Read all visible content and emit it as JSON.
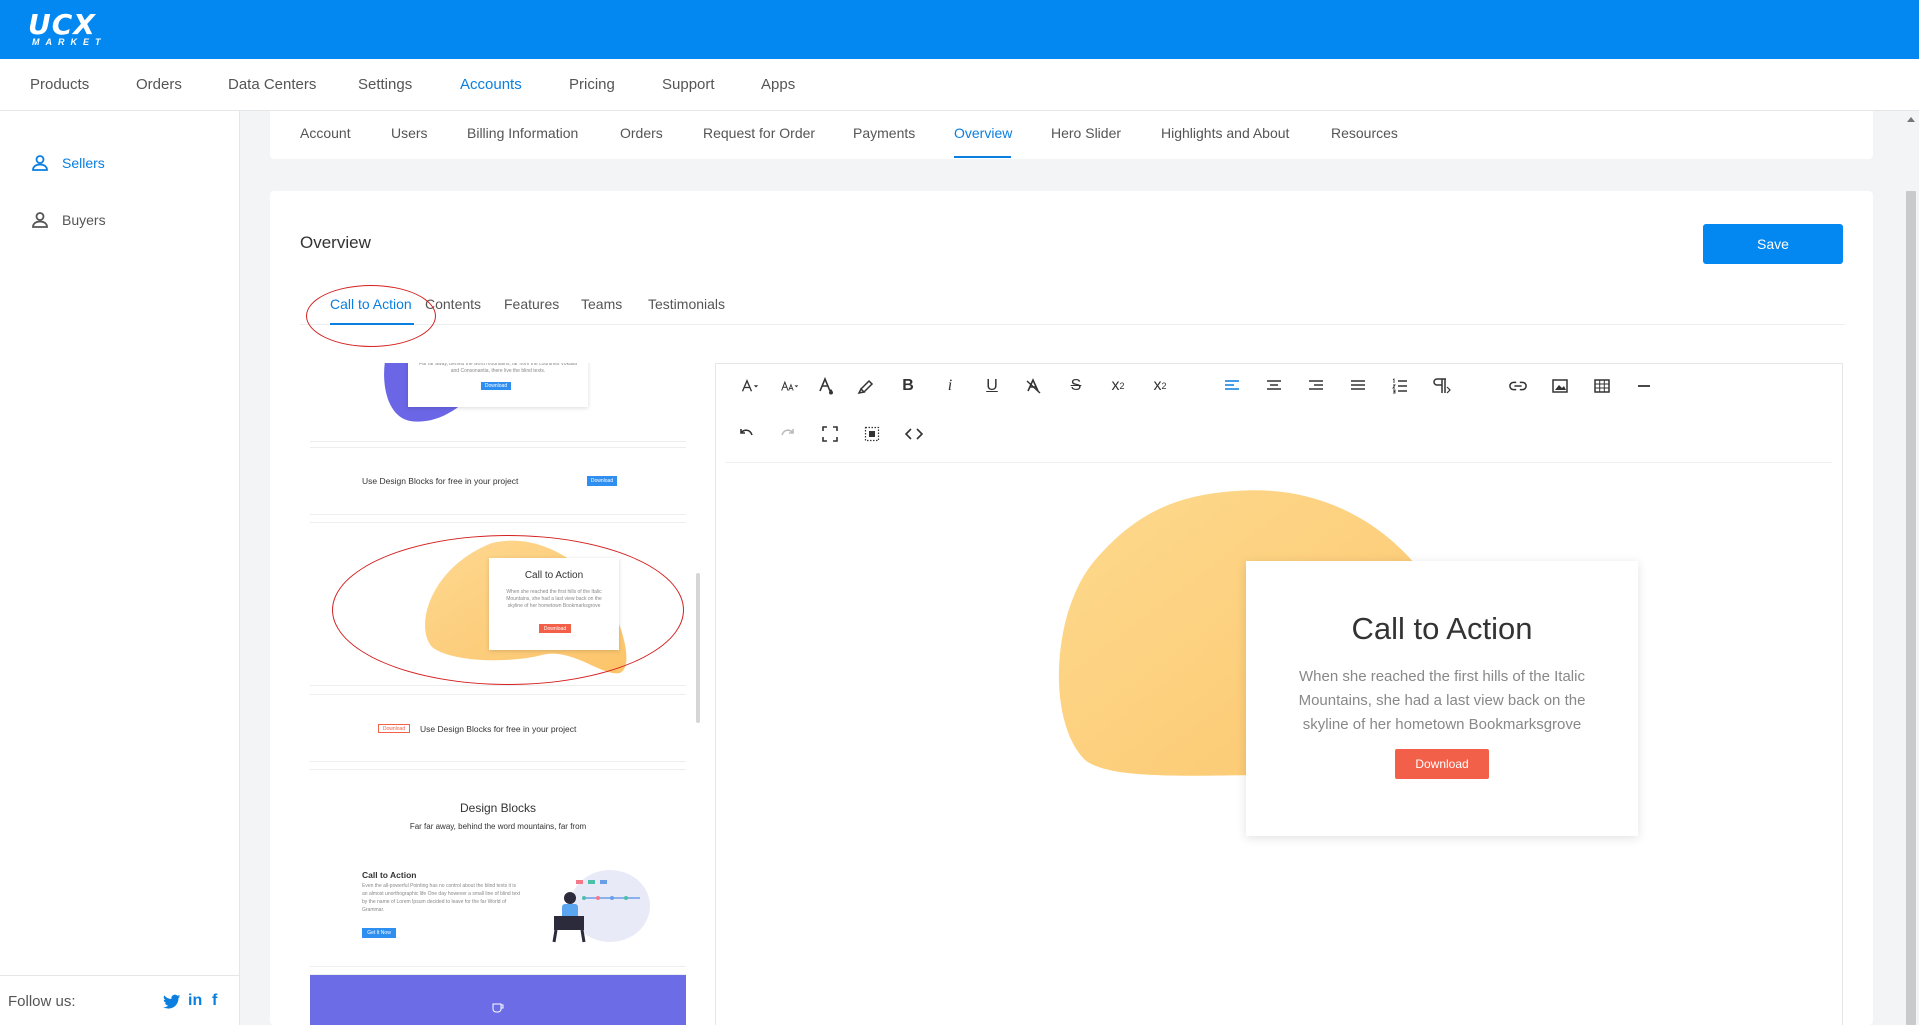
{
  "brand": {
    "logo_main": "UCX",
    "logo_sub": "MARKET"
  },
  "main_nav": {
    "items": [
      "Products",
      "Orders",
      "Data Centers",
      "Settings",
      "Accounts",
      "Pricing",
      "Support",
      "Apps"
    ],
    "active": "Accounts"
  },
  "sidebar": {
    "items": [
      {
        "label": "Sellers",
        "icon": "user-icon",
        "active": true
      },
      {
        "label": "Buyers",
        "icon": "user-icon",
        "active": false
      }
    ],
    "follow_label": "Follow us:",
    "social": [
      "twitter-icon",
      "linkedin-icon",
      "facebook-icon"
    ]
  },
  "sub_nav": {
    "items": [
      "Account",
      "Users",
      "Billing Information",
      "Orders",
      "Request for Order",
      "Payments",
      "Overview",
      "Hero Slider",
      "Highlights and About",
      "Resources"
    ],
    "active": "Overview"
  },
  "overview": {
    "title": "Overview",
    "save_label": "Save",
    "tabs": [
      "Call to Action",
      "Contents",
      "Features",
      "Teams",
      "Testimonials"
    ],
    "active_tab": "Call to Action"
  },
  "blocks": {
    "b1": {
      "text": "Far far away, behind the word mountains, far from the countries Vokalia and Consonantia, there live the blind texts.",
      "btn": "Download"
    },
    "b2": {
      "text": "Use Design Blocks for free in your project",
      "btn": "Download"
    },
    "b3": {
      "title": "Call to Action",
      "text": "When she reached the first hills of the Italic Mountains, she had a last view back on the skyline of her hometown Bookmarksgrove",
      "btn": "Download"
    },
    "b4": {
      "btn": "Download",
      "text": "Use Design Blocks for free in your project"
    },
    "b5": {
      "title": "Design Blocks",
      "subtitle": "Far far away, behind the word mountains, far from",
      "cta_title": "Call to Action",
      "cta_text": "Even the all-powerful Pointing has no control about the blind texts it is an almost unorthographic life One day however a small line of blind text by the name of Lorem Ipsum decided to leave for the far World of Grammar.",
      "btn": "Get It Now"
    }
  },
  "editor": {
    "content": {
      "title": "Call to Action",
      "description": "When she reached the first hills of the Italic Mountains, she had a last view back on the skyline of her hometown Bookmarksgrove",
      "button": "Download"
    },
    "colors": {
      "blob": "#fdcf7c",
      "button": "#f2604a"
    }
  },
  "colors": {
    "brand": "#0288f0",
    "accent": "#0a7fe0",
    "annotation": "#d42020"
  }
}
